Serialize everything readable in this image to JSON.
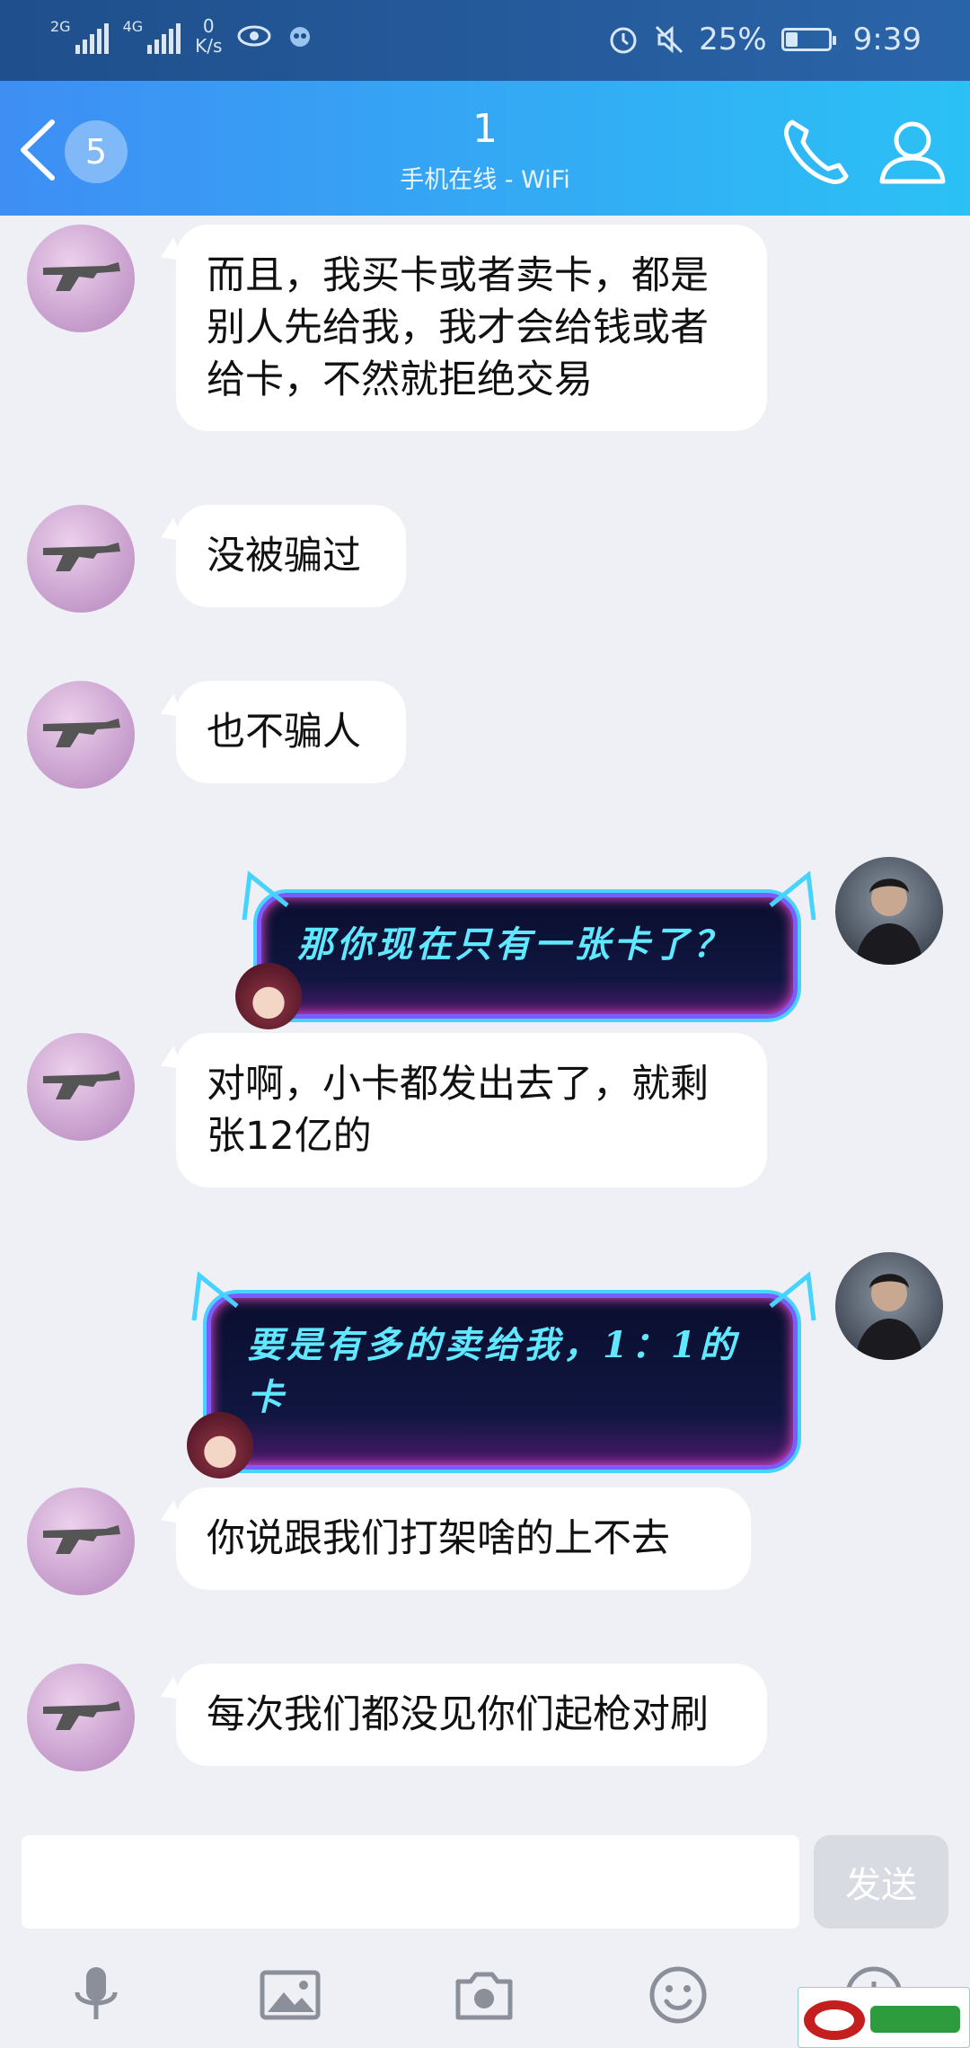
{
  "status_bar": {
    "net1": "2G",
    "net2": "4G",
    "speed_value": "0",
    "speed_unit": "K/s",
    "battery": "25%",
    "time": "9:39"
  },
  "header": {
    "back_count": "5",
    "title": "1",
    "subtitle": "手机在线 - WiFi"
  },
  "messages": [
    {
      "side": "left",
      "text": "而且，我买卡或者卖卡，都是别人先给我，我才会给钱或者给卡，不然就拒绝交易"
    },
    {
      "side": "left",
      "text": "没被骗过"
    },
    {
      "side": "left",
      "text": "也不骗人"
    },
    {
      "side": "right",
      "text": "那你现在只有一张卡了？"
    },
    {
      "side": "left",
      "text": "对啊，小卡都发出去了，就剩张12亿的"
    },
    {
      "side": "right",
      "text": "要是有多的卖给我，1：1的卡"
    },
    {
      "side": "left",
      "text": "你说跟我们打架啥的上不去"
    },
    {
      "side": "left",
      "text": "每次我们都没见你们起枪对刷"
    }
  ],
  "input": {
    "value": "",
    "send_label": "发送"
  },
  "toolbar": [
    "microphone-icon",
    "image-icon",
    "camera-icon",
    "emoji-icon",
    "plus-icon"
  ]
}
